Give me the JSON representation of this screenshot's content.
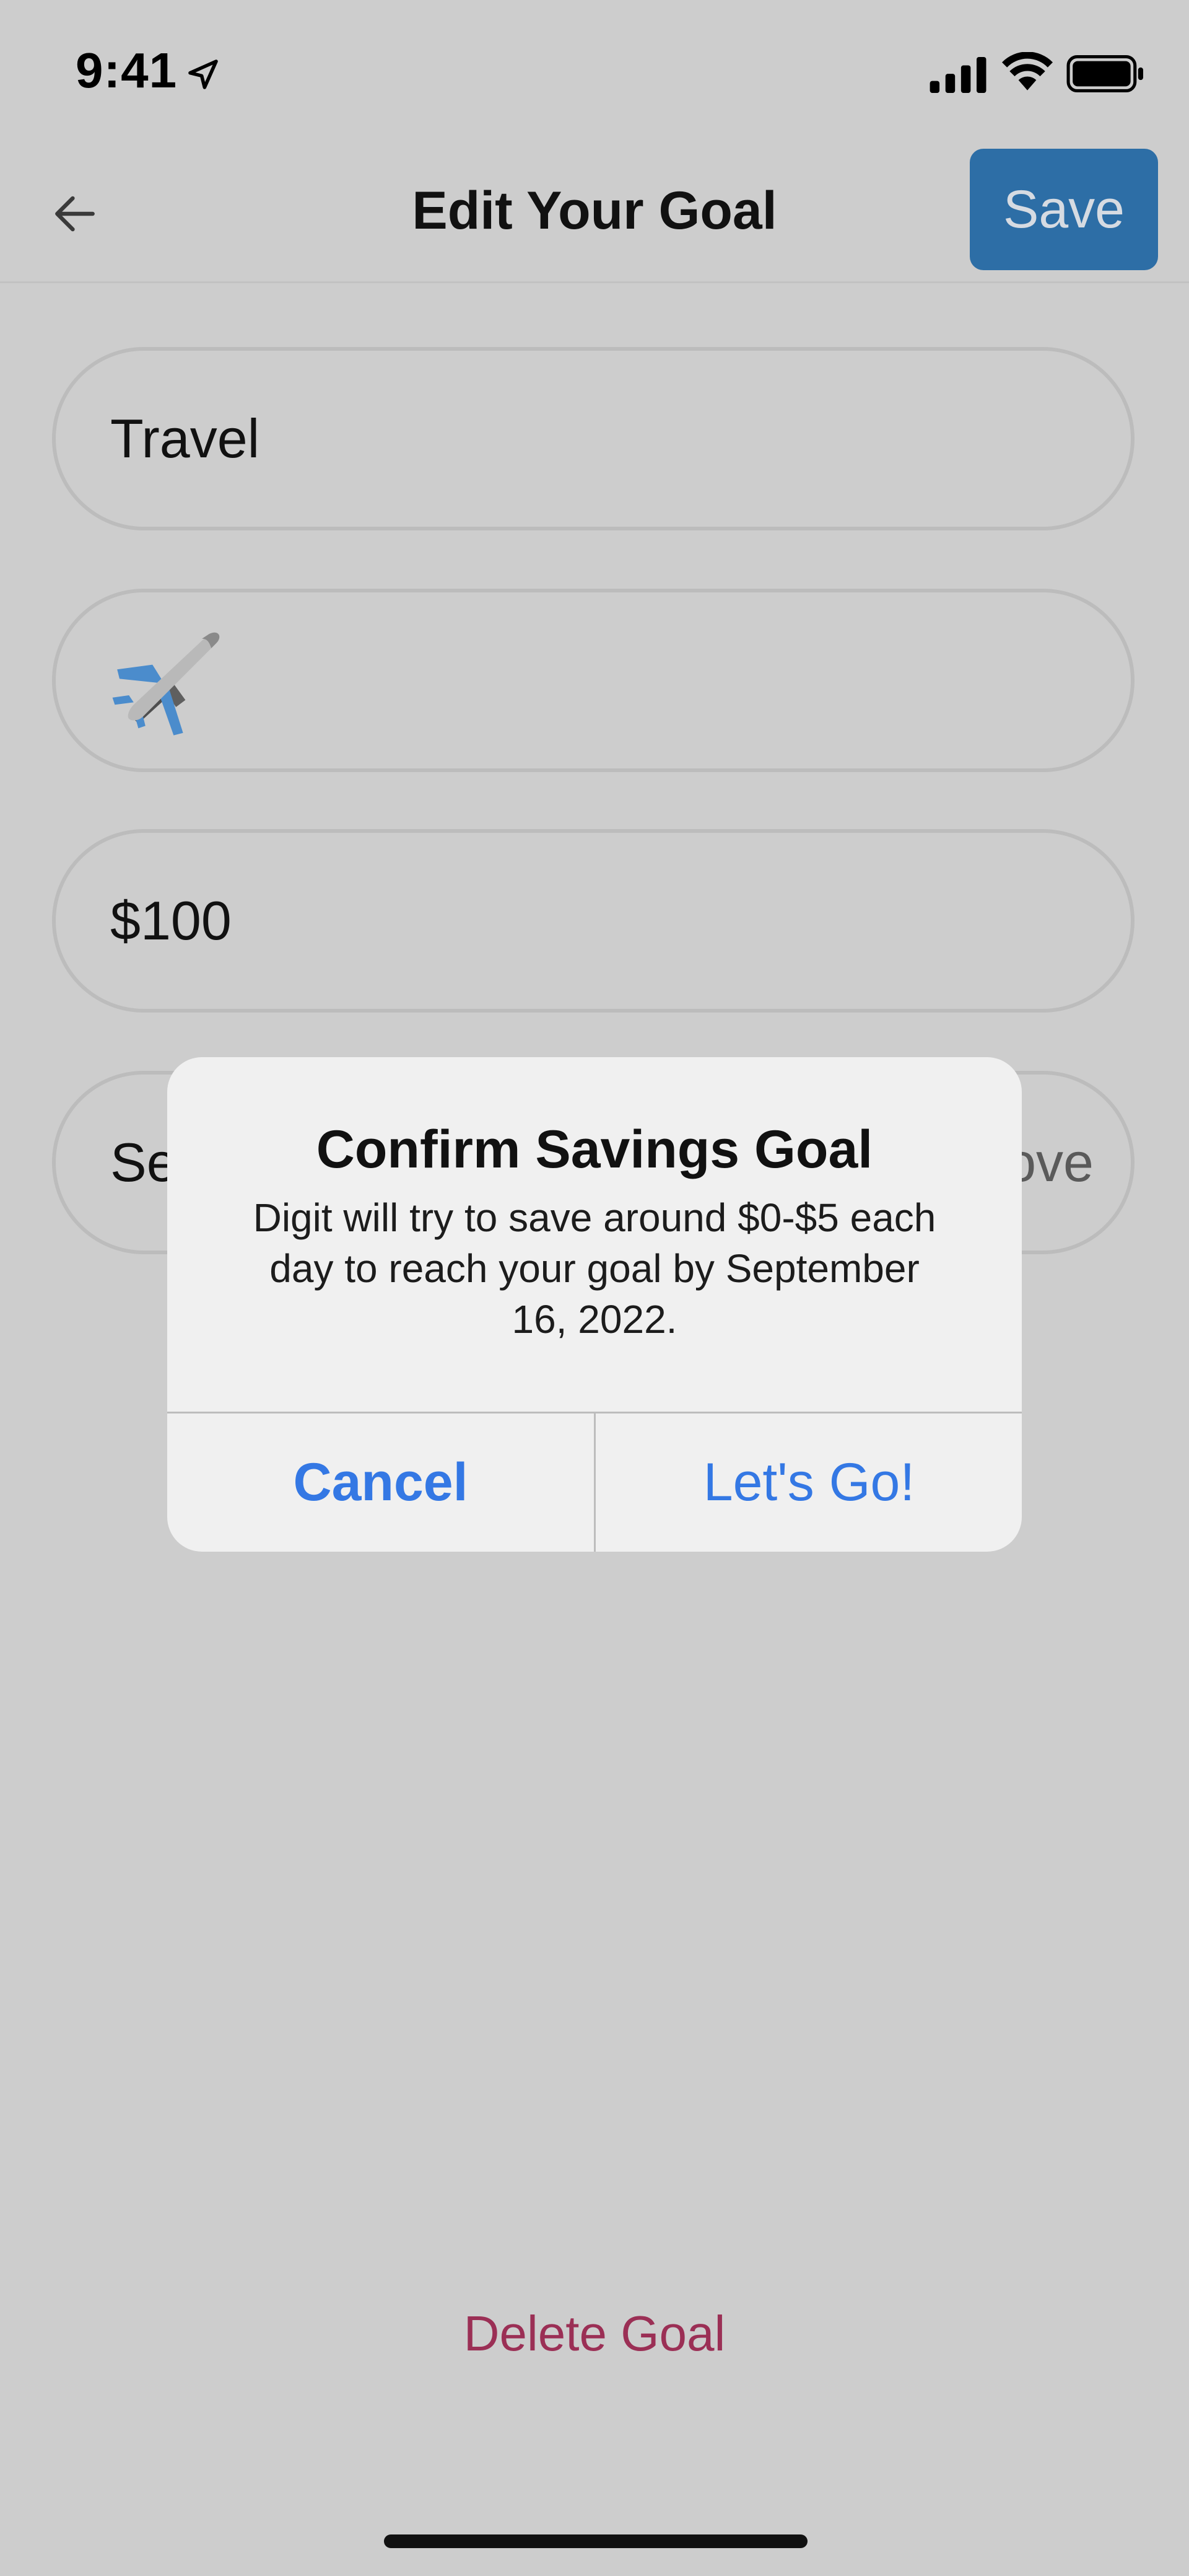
{
  "status_bar": {
    "time": "9:41",
    "icons": [
      "location-arrow-icon",
      "cellular-signal-icon",
      "wifi-icon",
      "battery-icon"
    ]
  },
  "nav": {
    "back_icon": "arrow-left-icon",
    "title": "Edit Your Goal",
    "save_label": "Save"
  },
  "form": {
    "name_value": "Travel",
    "icon_value": "airplane-emoji",
    "amount_value": "$100",
    "date_value_partial": "Se",
    "date_hint_partial": "ove"
  },
  "dialog": {
    "title": "Confirm Savings Goal",
    "message": "Digit will try to save around $0-$5 each day to reach your goal by September 16, 2022.",
    "cancel_label": "Cancel",
    "confirm_label": "Let's Go!"
  },
  "footer": {
    "delete_label": "Delete Goal"
  },
  "colors": {
    "background": "#cdcdcd",
    "save_button": "#2d6ea6",
    "dialog_background": "#f0f0f0",
    "dialog_button_text": "#3478e4",
    "delete_text": "#9b2f55"
  }
}
